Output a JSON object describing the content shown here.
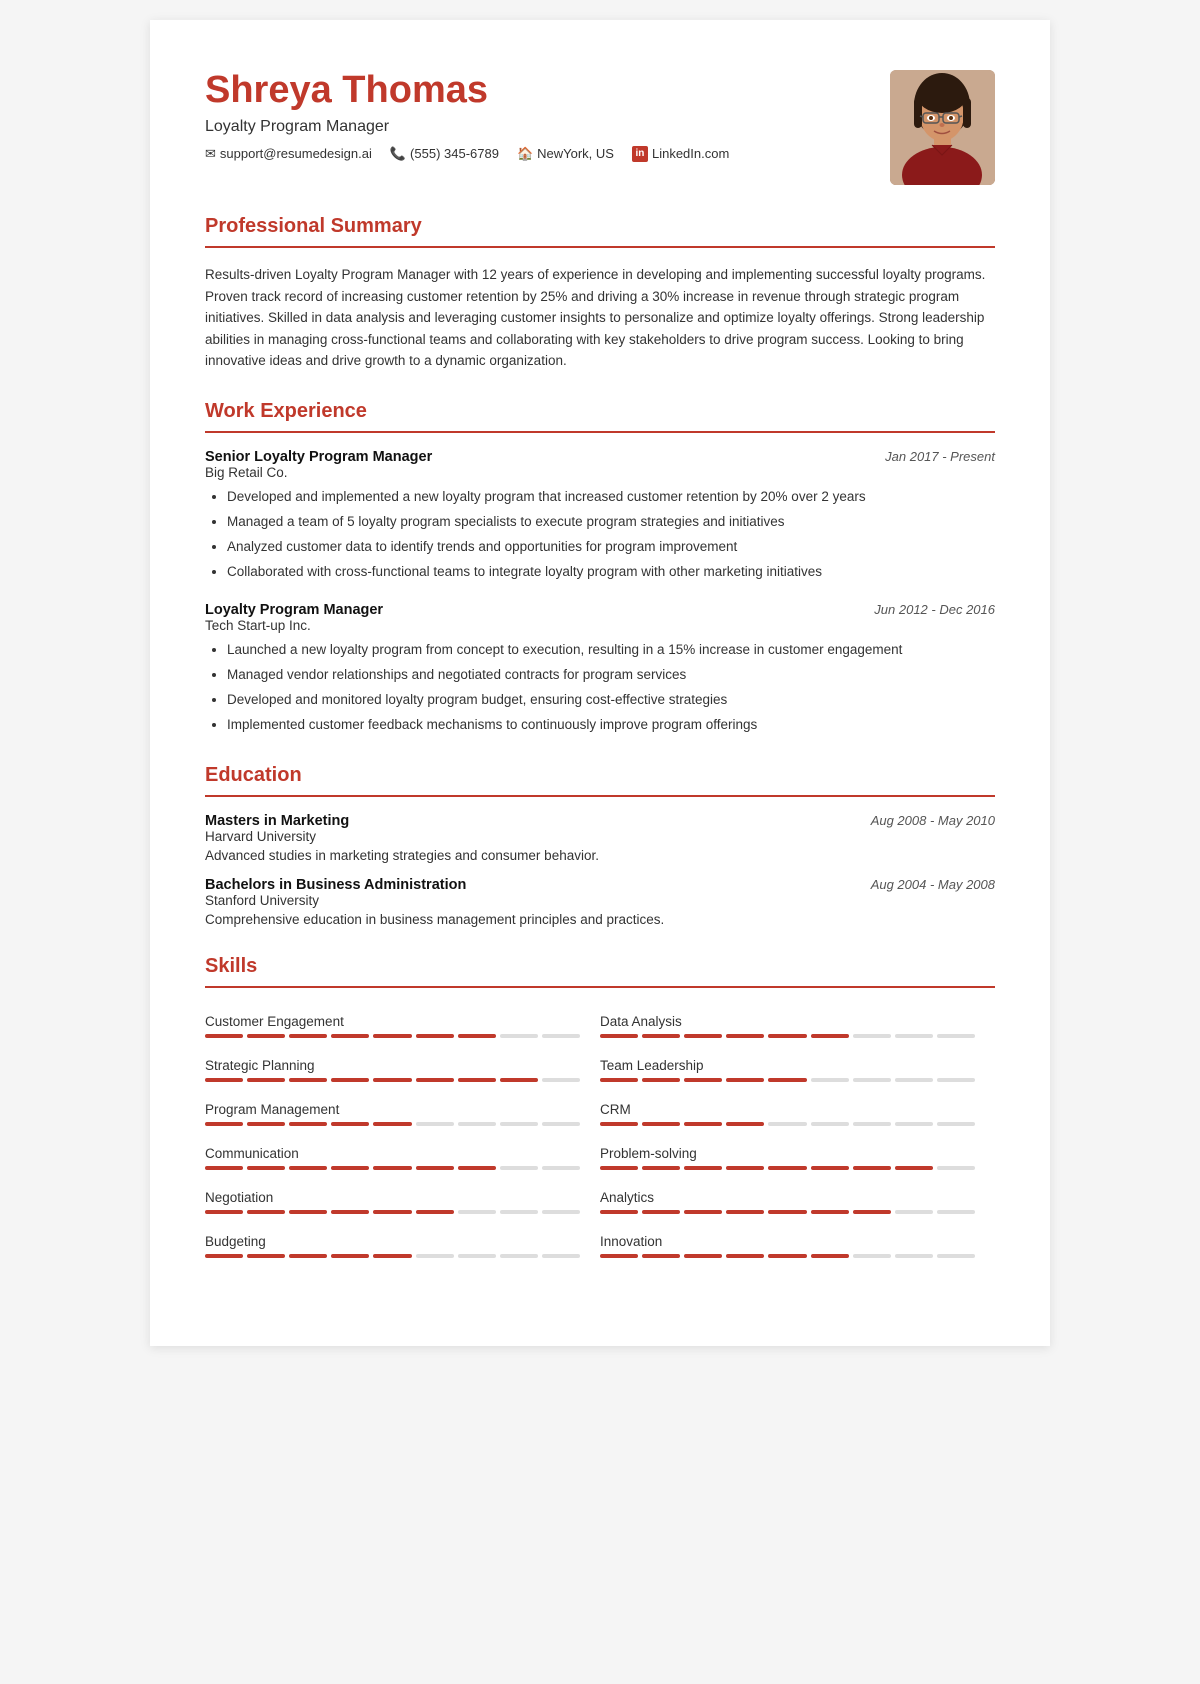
{
  "header": {
    "name": "Shreya Thomas",
    "title": "Loyalty Program Manager",
    "contact": {
      "email": "support@resumedesign.ai",
      "phone": "(555) 345-6789",
      "location": "NewYork, US",
      "linkedin": "LinkedIn.com"
    }
  },
  "sections": {
    "summary": {
      "title": "Professional Summary",
      "text": "Results-driven Loyalty Program Manager with 12 years of experience in developing and implementing successful loyalty programs. Proven track record of increasing customer retention by 25% and driving a 30% increase in revenue through strategic program initiatives. Skilled in data analysis and leveraging customer insights to personalize and optimize loyalty offerings. Strong leadership abilities in managing cross-functional teams and collaborating with key stakeholders to drive program success. Looking to bring innovative ideas and drive growth to a dynamic organization."
    },
    "experience": {
      "title": "Work Experience",
      "jobs": [
        {
          "title": "Senior Loyalty Program Manager",
          "company": "Big Retail Co.",
          "date": "Jan 2017 - Present",
          "bullets": [
            "Developed and implemented a new loyalty program that increased customer retention by 20% over 2 years",
            "Managed a team of 5 loyalty program specialists to execute program strategies and initiatives",
            "Analyzed customer data to identify trends and opportunities for program improvement",
            "Collaborated with cross-functional teams to integrate loyalty program with other marketing initiatives"
          ]
        },
        {
          "title": "Loyalty Program Manager",
          "company": "Tech Start-up Inc.",
          "date": "Jun 2012 - Dec 2016",
          "bullets": [
            "Launched a new loyalty program from concept to execution, resulting in a 15% increase in customer engagement",
            "Managed vendor relationships and negotiated contracts for program services",
            "Developed and monitored loyalty program budget, ensuring cost-effective strategies",
            "Implemented customer feedback mechanisms to continuously improve program offerings"
          ]
        }
      ]
    },
    "education": {
      "title": "Education",
      "items": [
        {
          "degree": "Masters in Marketing",
          "school": "Harvard University",
          "date": "Aug 2008 - May 2010",
          "desc": "Advanced studies in marketing strategies and consumer behavior."
        },
        {
          "degree": "Bachelors in Business Administration",
          "school": "Stanford University",
          "date": "Aug 2004 - May 2008",
          "desc": "Comprehensive education in business management principles and practices."
        }
      ]
    },
    "skills": {
      "title": "Skills",
      "items": [
        {
          "name": "Customer Engagement",
          "level": 7,
          "max": 9,
          "col": 0
        },
        {
          "name": "Data Analysis",
          "level": 6,
          "max": 9,
          "col": 1
        },
        {
          "name": "Strategic Planning",
          "level": 8,
          "max": 9,
          "col": 0
        },
        {
          "name": "Team Leadership",
          "level": 5,
          "max": 9,
          "col": 1
        },
        {
          "name": "Program Management",
          "level": 5,
          "max": 9,
          "col": 0
        },
        {
          "name": "CRM",
          "level": 4,
          "max": 9,
          "col": 1
        },
        {
          "name": "Communication",
          "level": 7,
          "max": 9,
          "col": 0
        },
        {
          "name": "Problem-solving",
          "level": 8,
          "max": 9,
          "col": 1
        },
        {
          "name": "Negotiation",
          "level": 6,
          "max": 9,
          "col": 0
        },
        {
          "name": "Analytics",
          "level": 7,
          "max": 9,
          "col": 1
        },
        {
          "name": "Budgeting",
          "level": 5,
          "max": 9,
          "col": 0
        },
        {
          "name": "Innovation",
          "level": 6,
          "max": 9,
          "col": 1
        }
      ]
    }
  },
  "colors": {
    "accent": "#c0392b"
  }
}
